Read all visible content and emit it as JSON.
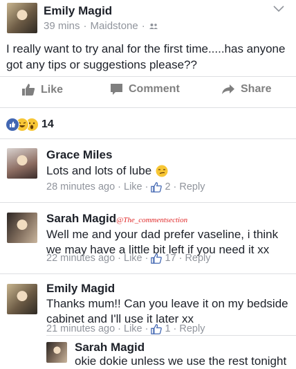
{
  "post": {
    "author": "Emily Magid",
    "time": "39 mins",
    "location": "Maidstone",
    "text": "I really want to try anal for the first time.....has anyone got any tips or suggestions please??"
  },
  "actions": {
    "like": "Like",
    "comment": "Comment",
    "share": "Share"
  },
  "reactions": {
    "count": "14"
  },
  "comments": [
    {
      "author": "Grace Miles",
      "text": "Lots and lots of lube",
      "time": "28 minutes ago",
      "like": "Like",
      "likes": "2",
      "reply": "Reply"
    },
    {
      "author": "Sarah Magid",
      "watermark": "@The_commentsection",
      "text": "Well me and your dad prefer vaseline, i think we may have a little bit left if you need it xx",
      "time": "22 minutes ago",
      "like": "Like",
      "likes": "17",
      "reply": "Reply"
    },
    {
      "author": "Emily Magid",
      "text": "Thanks mum!! Can you leave it on my bedside cabinet and I'll use it later xx",
      "time": "21 minutes ago",
      "like": "Like",
      "likes": "1",
      "reply": "Reply"
    },
    {
      "author": "Sarah Magid",
      "text": "okie dokie unless we use the rest tonight"
    }
  ],
  "colors": {
    "facebook_blue": "#4267b2",
    "meta_gray": "#90949c",
    "watermark_red": "#e02a2a"
  }
}
